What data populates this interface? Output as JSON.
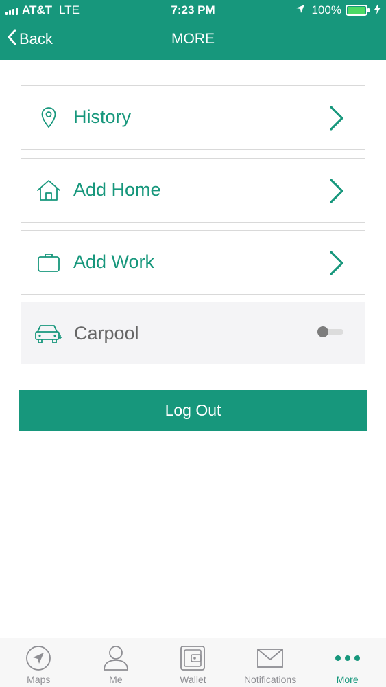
{
  "status_bar": {
    "carrier": "AT&T",
    "network": "LTE",
    "time": "7:23 PM",
    "battery_percent": "100%",
    "battery_level": 1.0,
    "icons": [
      "signal-bars-icon",
      "location-arrow-icon",
      "battery-icon",
      "charging-bolt-icon"
    ]
  },
  "nav": {
    "back_label": "Back",
    "title": "MORE"
  },
  "menu": {
    "items": [
      {
        "label": "History",
        "icon": "map-pin-icon"
      },
      {
        "label": "Add Home",
        "icon": "house-icon"
      },
      {
        "label": "Add Work",
        "icon": "briefcase-icon"
      }
    ]
  },
  "carpool": {
    "label": "Carpool",
    "icon": "car-plus-icon",
    "enabled": false
  },
  "logout_label": "Log Out",
  "tabs": [
    {
      "label": "Maps",
      "icon": "compass-arrow-icon",
      "active": false
    },
    {
      "label": "Me",
      "icon": "person-icon",
      "active": false
    },
    {
      "label": "Wallet",
      "icon": "wallet-icon",
      "active": false
    },
    {
      "label": "Notifications",
      "icon": "envelope-icon",
      "active": false
    },
    {
      "label": "More",
      "icon": "more-dots-icon",
      "active": true
    }
  ],
  "colors": {
    "accent": "#17977c",
    "row_text_disabled": "#666666",
    "carpool_background": "#f4f4f6",
    "tab_inactive": "#8e8e93"
  }
}
